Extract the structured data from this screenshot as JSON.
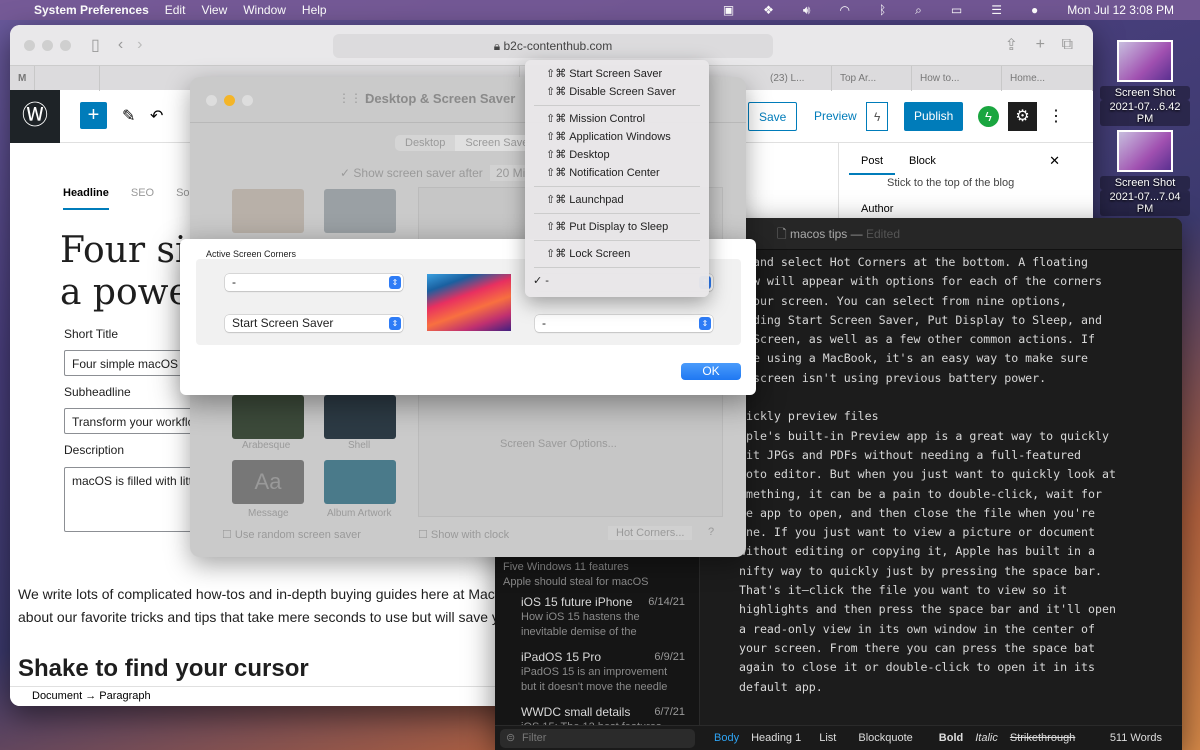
{
  "menubar": {
    "app": "System Preferences",
    "items": [
      "Edit",
      "View",
      "Window",
      "Help"
    ],
    "clock": "Mon Jul 12  3:08 PM"
  },
  "desktop": {
    "icons": [
      {
        "label1": "Screen Shot",
        "label2": "2021-07...6.42 PM"
      },
      {
        "label1": "Screen Shot",
        "label2": "2021-07...7.04 PM"
      }
    ]
  },
  "safari": {
    "url": "b2c-contenthub.com",
    "tabs": [
      "M",
      "(23) L...",
      "Top Ar...",
      "How to...",
      "Home..."
    ]
  },
  "wp": {
    "save": "Save",
    "preview": "Preview",
    "publish": "Publish",
    "tabs": [
      "Headline",
      "SEO",
      "So"
    ],
    "title": "Four sin",
    "title2": "a power",
    "short_title_label": "Short Title",
    "short_title": "Four simple macOS ti",
    "subheadline_label": "Subheadline",
    "subheadline": "Transform your workflo",
    "description_label": "Description",
    "description": "macOS is filled with littl",
    "para1": "We write lots of complicated how-tos and in-depth buying guides here at Macw",
    "para2": "about our favorite tricks and tips that take mere seconds to use but will save yo",
    "heading": "Shake to find your cursor",
    "breadcrumb": [
      "Document",
      "Paragraph"
    ],
    "sidebar": {
      "tabs": [
        "Post",
        "Block"
      ],
      "sticky": "Stick to the top of the blog",
      "author": "Author"
    }
  },
  "screensaver": {
    "title": "Desktop & Screen Saver",
    "tabs": [
      "Desktop",
      "Screen Save"
    ],
    "show_after": "Show screen saver after",
    "time": "20 Mi",
    "savers": [
      "Arabesque",
      "Shell",
      "Message",
      "Album Artwork"
    ],
    "random": "Use random screen saver",
    "clock": "Show with clock",
    "options": "Screen Saver Options...",
    "hot_corners": "Hot Corners...",
    "help": "?"
  },
  "sheet": {
    "title": "Active Screen Corners",
    "top_left": "-",
    "bottom_left": "Start Screen Saver",
    "bottom_right": "-",
    "ok": "OK"
  },
  "menu": {
    "groups": [
      [
        "Start Screen Saver",
        "Disable Screen Saver"
      ],
      [
        "Mission Control",
        "Application Windows",
        "Desktop",
        "Notification Center"
      ],
      [
        "Launchpad"
      ],
      [
        "Put Display to Sleep"
      ],
      [
        "Lock Screen"
      ]
    ],
    "modifier": "⇧⌘",
    "selected": "-"
  },
  "writer": {
    "title": "macos tips",
    "status": "Edited",
    "lines": [
      ", and select Hot Corners at the bottom. A floating",
      "dow will appear with options for each of the corners",
      " your screen. You can select from nine options,",
      "luding Start Screen Saver, Put Display to Sleep, and",
      "k Screen, as well as a few other common actions. If",
      "'re using a MacBook, it's an easy way to make sure",
      "r screen isn't using previous battery power.",
      "",
      "uickly preview files",
      "pple's built-in Preview app is a great way to quickly",
      "dit JPGs and PDFs without needing a full-featured",
      "hoto editor. But when you just want to quickly look at",
      "omething, it can be a pain to double-click, wait for",
      "he app to open, and then close the file when you're",
      "one. If you just want to view a picture or document",
      "without editing or copying it, Apple has built in a",
      "nifty way to quickly just by pressing the space bar.",
      "That's it—click the file you want to view so it",
      "highlights and then press the space bar and it'll open",
      "a read-only view in its own window in the center of",
      "your screen. From there you can press the space bat",
      "again to close it or double-click to open it in its",
      "default app."
    ],
    "list": [
      {
        "title": "",
        "date": "",
        "preview": [
          "Five Windows 11 features",
          "Apple should steal for macOS"
        ]
      },
      {
        "title": "iOS 15 future iPhone",
        "date": "6/14/21",
        "preview": [
          "How iOS 15 hastens the",
          "inevitable demise of the"
        ]
      },
      {
        "title": "iPadOS 15 Pro",
        "date": "6/9/21",
        "preview": [
          "iPadOS 15 is an improvement",
          "but it doesn't move the needle"
        ]
      },
      {
        "title": "WWDC small details",
        "date": "6/7/21",
        "preview": [
          "iOS 15: The 12 best features"
        ]
      }
    ],
    "filter_placeholder": "Filter",
    "toolbar": {
      "body": "Body",
      "heading": "Heading 1",
      "list": "List",
      "blockquote": "Blockquote",
      "bold": "Bold",
      "italic": "Italic",
      "strike": "Strikethrough",
      "words": "511 Words"
    }
  },
  "colors": {
    "accent": "#007cba",
    "macblue": "#2e7cf6",
    "writer_bg": "#1c1c1c"
  }
}
